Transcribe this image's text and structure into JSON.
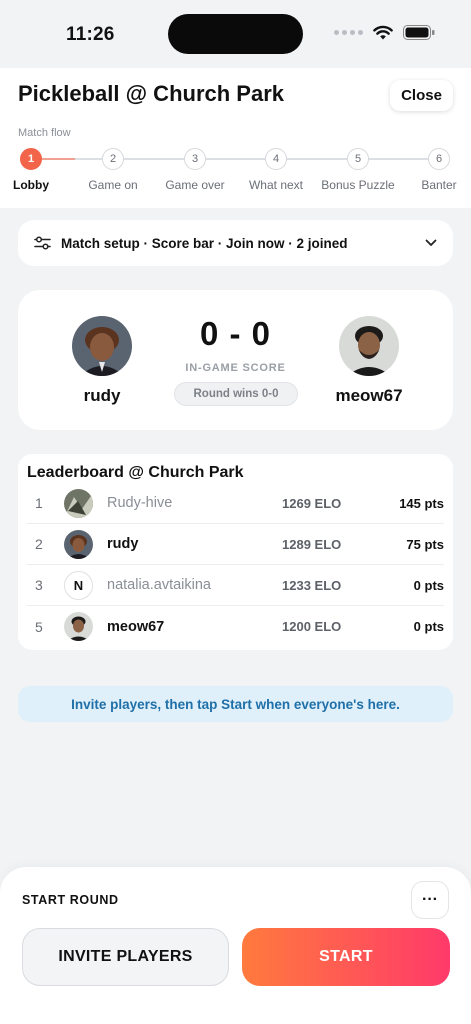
{
  "status_bar": {
    "time": "11:26"
  },
  "header": {
    "title": "Pickleball @ Church Park",
    "close_label": "Close",
    "flow_label": "Match flow",
    "steps": [
      {
        "number": "1",
        "label": "Lobby",
        "active": true
      },
      {
        "number": "2",
        "label": "Game on"
      },
      {
        "number": "3",
        "label": "Game over"
      },
      {
        "number": "4",
        "label": "What next"
      },
      {
        "number": "5",
        "label": "Bonus Puzzle"
      },
      {
        "number": "6",
        "label": "Banter"
      }
    ]
  },
  "setup_bar": {
    "icon": "sliders-icon",
    "text": "Match setup · Score bar · Join now · 2 joined",
    "chevron": "chevron-down-icon"
  },
  "score": {
    "left_player": "rudy",
    "right_player": "meow67",
    "score": "0 - 0",
    "score_label": "IN-GAME SCORE",
    "round_wins": "Round wins 0-0"
  },
  "leaderboard": {
    "title": "Leaderboard @ Church Park",
    "rows": [
      {
        "rank": "1",
        "name": "Rudy-hive",
        "elo": "1269 ELO",
        "pts": "145 pts"
      },
      {
        "rank": "2",
        "name": "rudy",
        "elo": "1289 ELO",
        "pts": "75 pts"
      },
      {
        "rank": "3",
        "name": "natalia.avtaikina",
        "avatar_letter": "N",
        "elo": "1233 ELO",
        "pts": "0 pts"
      },
      {
        "rank": "5",
        "name": "meow67",
        "elo": "1200 ELO",
        "pts": "0 pts"
      }
    ]
  },
  "hint": "Invite players, then tap Start when everyone's here.",
  "bottom": {
    "label": "START ROUND",
    "more": "···",
    "invite_label": "INVITE PLAYERS",
    "start_label": "START"
  },
  "colors": {
    "accent": "#f2654a",
    "start_gradient_from": "#ff7a3d",
    "start_gradient_to": "#ff3a6a",
    "hint_bg": "#dff0fb",
    "hint_text": "#1f6fa8"
  }
}
